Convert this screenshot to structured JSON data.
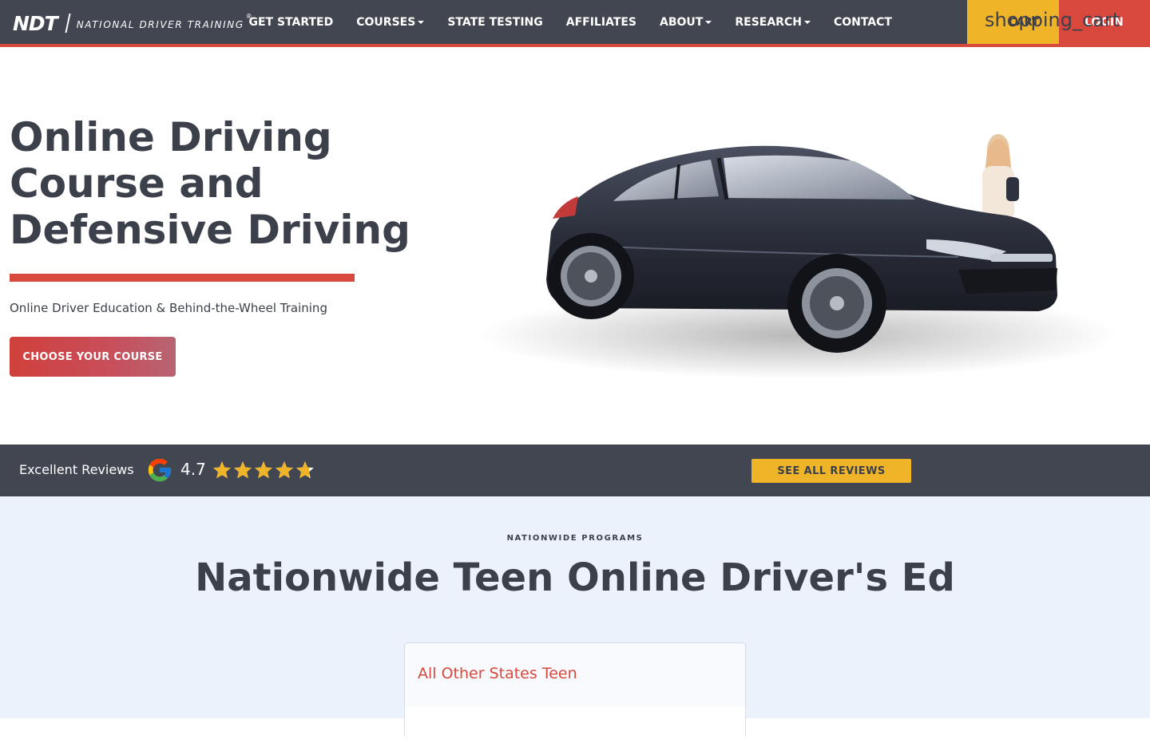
{
  "brand": {
    "logo_mark": "NDT",
    "logo_text": "NATIONAL DRIVER TRAINING",
    "registered": "®"
  },
  "nav": {
    "items": [
      {
        "label": "GET STARTED",
        "dropdown": false
      },
      {
        "label": "COURSES",
        "dropdown": true
      },
      {
        "label": "STATE TESTING",
        "dropdown": false
      },
      {
        "label": "AFFILIATES",
        "dropdown": false
      },
      {
        "label": "ABOUT",
        "dropdown": true
      },
      {
        "label": "RESEARCH",
        "dropdown": true
      },
      {
        "label": "CONTACT",
        "dropdown": false
      }
    ],
    "cart_label": "CART",
    "cart_icon_text": "shopping_cart",
    "login_label": "LOGIN"
  },
  "hero": {
    "title": "Online Driving Course and Defensive Driving",
    "subtitle": "Online Driver Education & Behind-the-Wheel Training",
    "cta_label": "CHOOSE YOUR COURSE"
  },
  "reviews": {
    "label": "Excellent Reviews",
    "rating": "4.7",
    "stars_value": 4.7,
    "stars_max": 5,
    "button_label": "SEE ALL REVIEWS"
  },
  "nationwide": {
    "eyebrow": "NATIONWIDE PROGRAMS",
    "title": "Nationwide Teen Online Driver's Ed",
    "card_title": "All Other States Teen"
  },
  "colors": {
    "nav_bg": "#424650",
    "accent_red": "#d9483d",
    "accent_yellow": "#f0b429",
    "section_bg": "#ecf2fb",
    "text_dark": "#3c404b"
  }
}
